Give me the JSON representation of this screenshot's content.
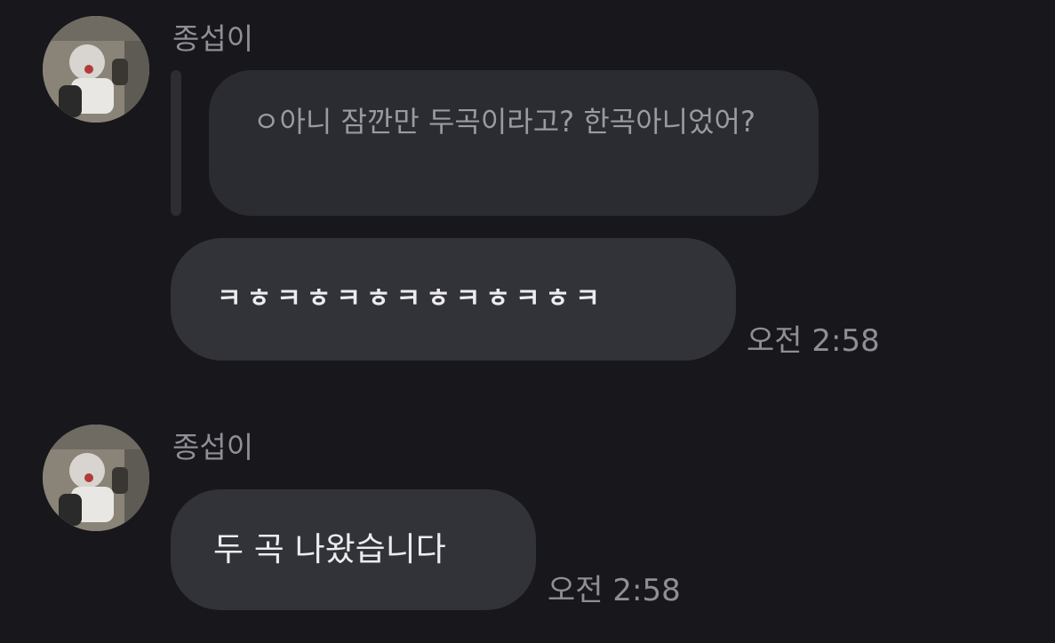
{
  "messages": [
    {
      "sender": "종섭이",
      "avatar_icon": "profile-photo-icon",
      "quoted_reply": "ㅇ아니 잠깐만 두곡이라고? 한곡아니었어?",
      "text": "ㅋㅎㅋㅎㅋㅎㅋㅎㅋㅎㅋㅎㅋ",
      "time": "오전 2:58"
    },
    {
      "sender": "종섭이",
      "avatar_icon": "profile-photo-icon",
      "text": "두 곡 나왔습니다",
      "time": "오전 2:58"
    }
  ],
  "colors": {
    "background": "#17171c",
    "bubble": "#323338",
    "quoted_bubble": "#2b2c31",
    "secondary_text": "#8f8f96",
    "primary_text": "#ececf0"
  }
}
